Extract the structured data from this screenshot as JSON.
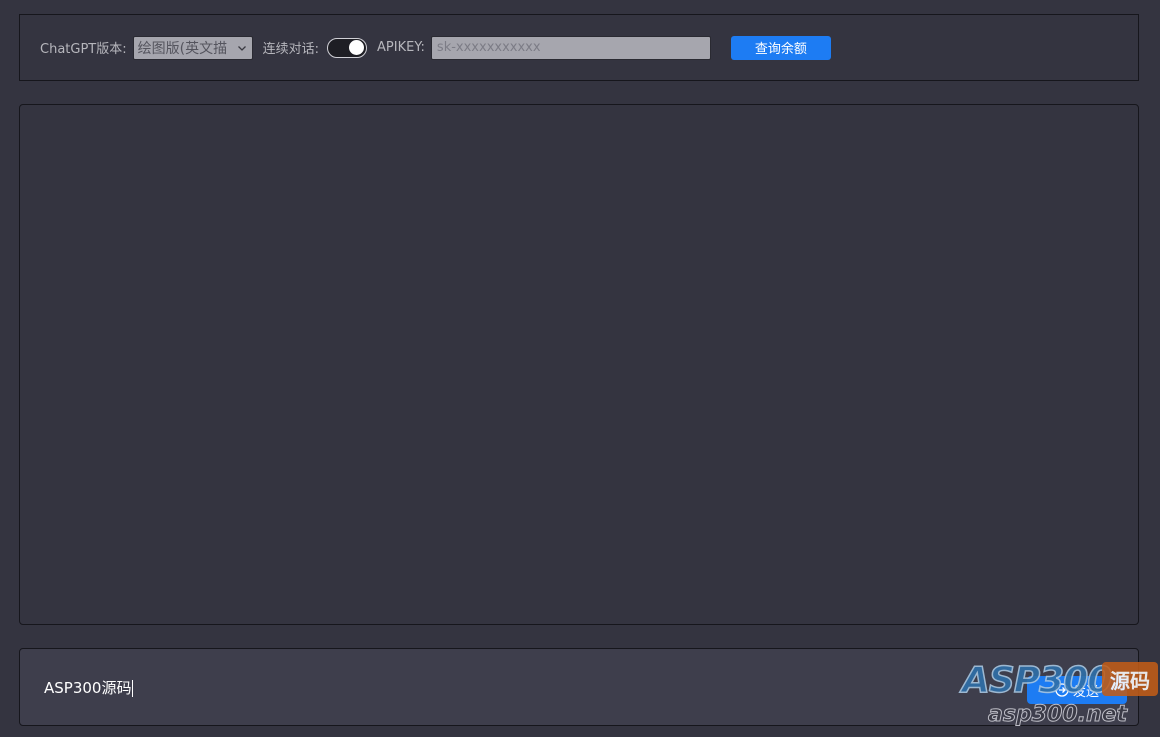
{
  "settings": {
    "version_label": "ChatGPT版本:",
    "version_selected": "绘图版(英文描",
    "continuous_label": "连续对话:",
    "continuous_enabled": true,
    "apikey_label": "APIKEY:",
    "apikey_placeholder": "sk-xxxxxxxxxxx",
    "query_button_label": "查询余额"
  },
  "input": {
    "value": "ASP300源码",
    "send_button_label": "发送"
  },
  "watermark": {
    "brand": "ASP300",
    "tag": "源码",
    "url": "asp300.net"
  },
  "colors": {
    "background": "#343440",
    "accent": "#1d7cf3",
    "input_area": "#3e3e4c"
  },
  "icons": {
    "select_chevron": "chevron-down-icon",
    "send": "send-icon"
  }
}
